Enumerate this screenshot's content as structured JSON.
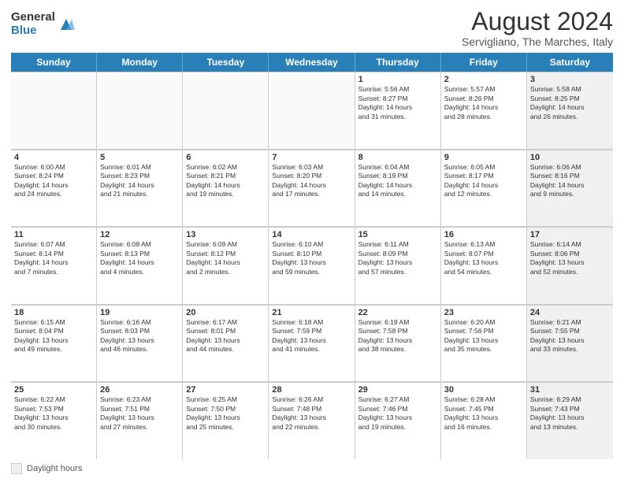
{
  "logo": {
    "general": "General",
    "blue": "Blue"
  },
  "header": {
    "title": "August 2024",
    "location": "Servigliano, The Marches, Italy"
  },
  "days": [
    "Sunday",
    "Monday",
    "Tuesday",
    "Wednesday",
    "Thursday",
    "Friday",
    "Saturday"
  ],
  "footer": {
    "label": "Daylight hours"
  },
  "weeks": [
    [
      {
        "num": "",
        "lines": [],
        "empty": true
      },
      {
        "num": "",
        "lines": [],
        "empty": true
      },
      {
        "num": "",
        "lines": [],
        "empty": true
      },
      {
        "num": "",
        "lines": [],
        "empty": true
      },
      {
        "num": "1",
        "lines": [
          "Sunrise: 5:56 AM",
          "Sunset: 8:27 PM",
          "Daylight: 14 hours",
          "and 31 minutes."
        ]
      },
      {
        "num": "2",
        "lines": [
          "Sunrise: 5:57 AM",
          "Sunset: 8:26 PM",
          "Daylight: 14 hours",
          "and 28 minutes."
        ]
      },
      {
        "num": "3",
        "lines": [
          "Sunrise: 5:58 AM",
          "Sunset: 8:25 PM",
          "Daylight: 14 hours",
          "and 26 minutes."
        ],
        "shaded": true
      }
    ],
    [
      {
        "num": "4",
        "lines": [
          "Sunrise: 6:00 AM",
          "Sunset: 8:24 PM",
          "Daylight: 14 hours",
          "and 24 minutes."
        ]
      },
      {
        "num": "5",
        "lines": [
          "Sunrise: 6:01 AM",
          "Sunset: 8:23 PM",
          "Daylight: 14 hours",
          "and 21 minutes."
        ]
      },
      {
        "num": "6",
        "lines": [
          "Sunrise: 6:02 AM",
          "Sunset: 8:21 PM",
          "Daylight: 14 hours",
          "and 19 minutes."
        ]
      },
      {
        "num": "7",
        "lines": [
          "Sunrise: 6:03 AM",
          "Sunset: 8:20 PM",
          "Daylight: 14 hours",
          "and 17 minutes."
        ]
      },
      {
        "num": "8",
        "lines": [
          "Sunrise: 6:04 AM",
          "Sunset: 8:19 PM",
          "Daylight: 14 hours",
          "and 14 minutes."
        ]
      },
      {
        "num": "9",
        "lines": [
          "Sunrise: 6:05 AM",
          "Sunset: 8:17 PM",
          "Daylight: 14 hours",
          "and 12 minutes."
        ]
      },
      {
        "num": "10",
        "lines": [
          "Sunrise: 6:06 AM",
          "Sunset: 8:16 PM",
          "Daylight: 14 hours",
          "and 9 minutes."
        ],
        "shaded": true
      }
    ],
    [
      {
        "num": "11",
        "lines": [
          "Sunrise: 6:07 AM",
          "Sunset: 8:14 PM",
          "Daylight: 14 hours",
          "and 7 minutes."
        ]
      },
      {
        "num": "12",
        "lines": [
          "Sunrise: 6:08 AM",
          "Sunset: 8:13 PM",
          "Daylight: 14 hours",
          "and 4 minutes."
        ]
      },
      {
        "num": "13",
        "lines": [
          "Sunrise: 6:09 AM",
          "Sunset: 8:12 PM",
          "Daylight: 14 hours",
          "and 2 minutes."
        ]
      },
      {
        "num": "14",
        "lines": [
          "Sunrise: 6:10 AM",
          "Sunset: 8:10 PM",
          "Daylight: 13 hours",
          "and 59 minutes."
        ]
      },
      {
        "num": "15",
        "lines": [
          "Sunrise: 6:11 AM",
          "Sunset: 8:09 PM",
          "Daylight: 13 hours",
          "and 57 minutes."
        ]
      },
      {
        "num": "16",
        "lines": [
          "Sunrise: 6:13 AM",
          "Sunset: 8:07 PM",
          "Daylight: 13 hours",
          "and 54 minutes."
        ]
      },
      {
        "num": "17",
        "lines": [
          "Sunrise: 6:14 AM",
          "Sunset: 8:06 PM",
          "Daylight: 13 hours",
          "and 52 minutes."
        ],
        "shaded": true
      }
    ],
    [
      {
        "num": "18",
        "lines": [
          "Sunrise: 6:15 AM",
          "Sunset: 8:04 PM",
          "Daylight: 13 hours",
          "and 49 minutes."
        ]
      },
      {
        "num": "19",
        "lines": [
          "Sunrise: 6:16 AM",
          "Sunset: 8:03 PM",
          "Daylight: 13 hours",
          "and 46 minutes."
        ]
      },
      {
        "num": "20",
        "lines": [
          "Sunrise: 6:17 AM",
          "Sunset: 8:01 PM",
          "Daylight: 13 hours",
          "and 44 minutes."
        ]
      },
      {
        "num": "21",
        "lines": [
          "Sunrise: 6:18 AM",
          "Sunset: 7:59 PM",
          "Daylight: 13 hours",
          "and 41 minutes."
        ]
      },
      {
        "num": "22",
        "lines": [
          "Sunrise: 6:19 AM",
          "Sunset: 7:58 PM",
          "Daylight: 13 hours",
          "and 38 minutes."
        ]
      },
      {
        "num": "23",
        "lines": [
          "Sunrise: 6:20 AM",
          "Sunset: 7:56 PM",
          "Daylight: 13 hours",
          "and 35 minutes."
        ]
      },
      {
        "num": "24",
        "lines": [
          "Sunrise: 6:21 AM",
          "Sunset: 7:55 PM",
          "Daylight: 13 hours",
          "and 33 minutes."
        ],
        "shaded": true
      }
    ],
    [
      {
        "num": "25",
        "lines": [
          "Sunrise: 6:22 AM",
          "Sunset: 7:53 PM",
          "Daylight: 13 hours",
          "and 30 minutes."
        ]
      },
      {
        "num": "26",
        "lines": [
          "Sunrise: 6:23 AM",
          "Sunset: 7:51 PM",
          "Daylight: 13 hours",
          "and 27 minutes."
        ]
      },
      {
        "num": "27",
        "lines": [
          "Sunrise: 6:25 AM",
          "Sunset: 7:50 PM",
          "Daylight: 13 hours",
          "and 25 minutes."
        ]
      },
      {
        "num": "28",
        "lines": [
          "Sunrise: 6:26 AM",
          "Sunset: 7:48 PM",
          "Daylight: 13 hours",
          "and 22 minutes."
        ]
      },
      {
        "num": "29",
        "lines": [
          "Sunrise: 6:27 AM",
          "Sunset: 7:46 PM",
          "Daylight: 13 hours",
          "and 19 minutes."
        ]
      },
      {
        "num": "30",
        "lines": [
          "Sunrise: 6:28 AM",
          "Sunset: 7:45 PM",
          "Daylight: 13 hours",
          "and 16 minutes."
        ]
      },
      {
        "num": "31",
        "lines": [
          "Sunrise: 6:29 AM",
          "Sunset: 7:43 PM",
          "Daylight: 13 hours",
          "and 13 minutes."
        ],
        "shaded": true
      }
    ]
  ]
}
